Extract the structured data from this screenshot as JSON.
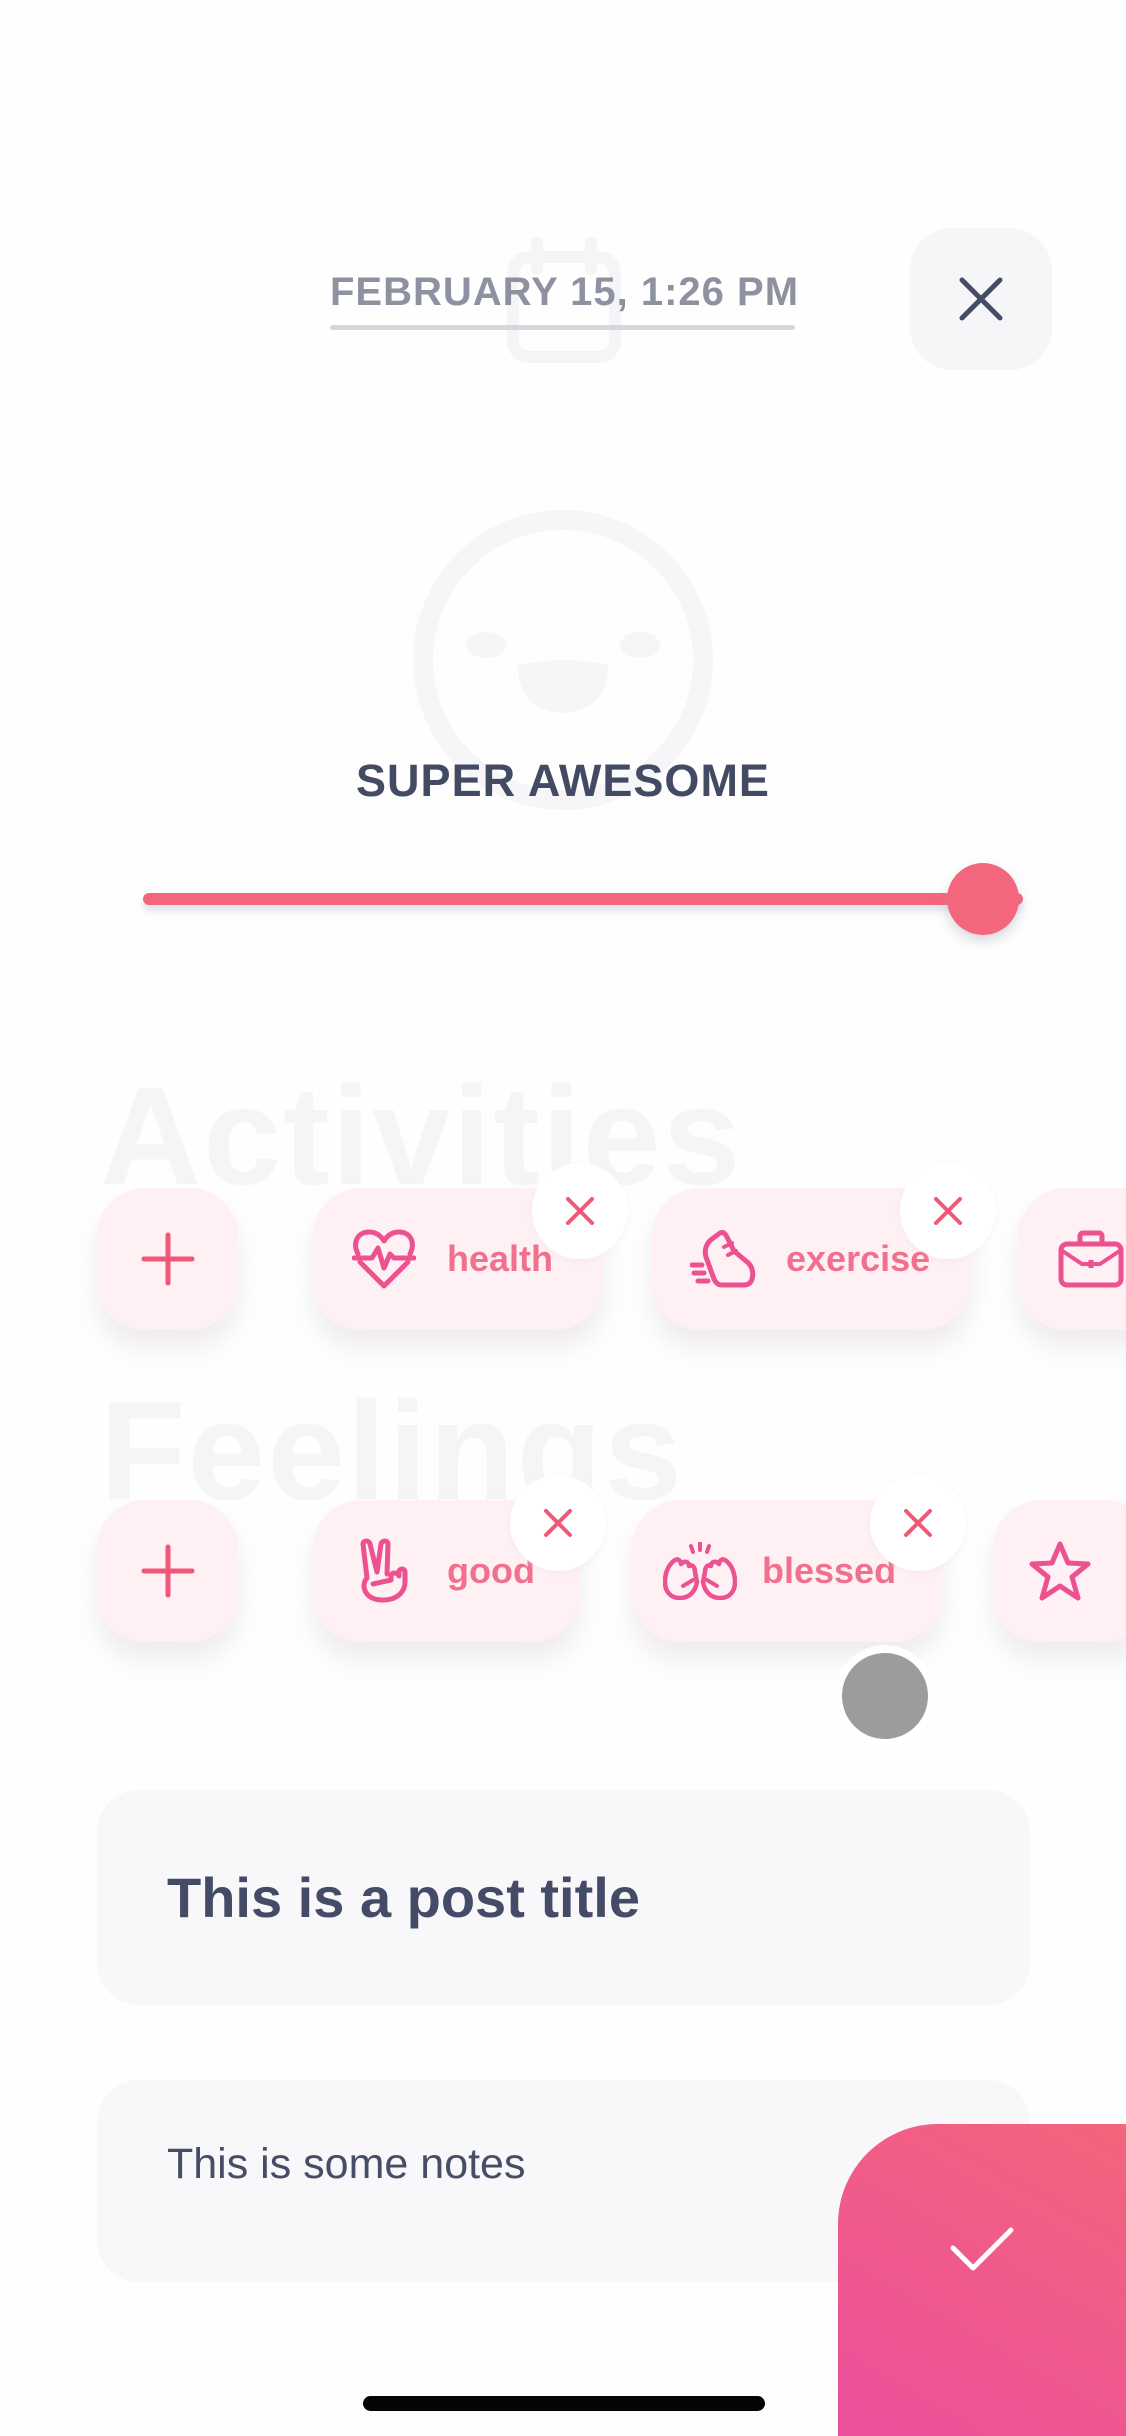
{
  "header": {
    "date_label": "FEBRUARY 15,  1:26 PM",
    "calendar_icon": "calendar-icon",
    "close_icon": "close-icon"
  },
  "mood": {
    "label": "SUPER AWESOME",
    "face_icon": "laughing-face-icon",
    "slider_value_fraction": 1.0,
    "accent_color": "#f4667e"
  },
  "activities": {
    "section_title": "Activities",
    "add_icon": "plus-icon",
    "items": [
      {
        "label": "health",
        "icon": "heart-pulse-icon",
        "removable": true
      },
      {
        "label": "exercise",
        "icon": "running-shoe-icon",
        "removable": true
      },
      {
        "label": "",
        "icon": "briefcase-icon",
        "removable": false
      }
    ]
  },
  "feelings": {
    "section_title": "Feelings",
    "add_icon": "plus-icon",
    "items": [
      {
        "label": "good",
        "icon": "peace-hand-icon",
        "removable": true
      },
      {
        "label": "blessed",
        "icon": "raised-hands-icon",
        "removable": true
      },
      {
        "label": "",
        "icon": "star-icon",
        "removable": false
      }
    ]
  },
  "post": {
    "title_value": "This is a post title",
    "notes_value": "This is some notes"
  },
  "actions": {
    "save_icon": "check-icon"
  },
  "colors": {
    "brand_pink": "#f0708e",
    "chip_bg": "#fff0f4",
    "text_dark": "#434b66",
    "fab_gradient_start": "#f4647b",
    "fab_gradient_end": "#ec4f9c"
  }
}
